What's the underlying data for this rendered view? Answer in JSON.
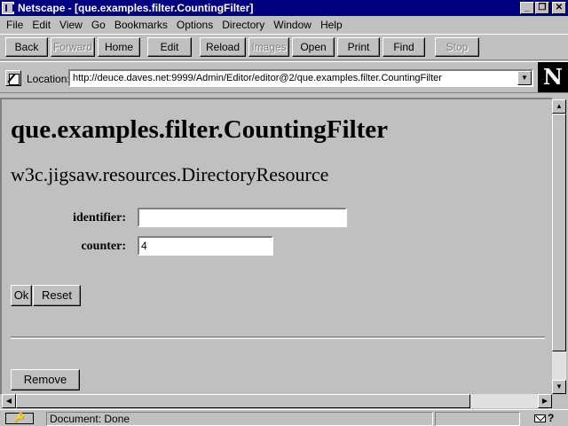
{
  "window": {
    "title": "Netscape - [que.examples.filter.CountingFilter]",
    "minimize_glyph": "_",
    "restore_glyph": "❐",
    "close_glyph": "✕"
  },
  "menu": [
    "File",
    "Edit",
    "View",
    "Go",
    "Bookmarks",
    "Options",
    "Directory",
    "Window",
    "Help"
  ],
  "toolbar": {
    "back": "Back",
    "forward": "Forward",
    "home": "Home",
    "edit": "Edit",
    "reload": "Reload",
    "images": "Images",
    "open": "Open",
    "print": "Print",
    "find": "Find",
    "stop": "Stop"
  },
  "location": {
    "label": "Location:",
    "url": "http://deuce.daves.net:9999/Admin/Editor/editor@2/que.examples.filter.CountingFilter",
    "dropdown_glyph": "▼"
  },
  "logo": {
    "letter": "N"
  },
  "page": {
    "heading": "que.examples.filter.CountingFilter",
    "subheading": "w3c.jigsaw.resources.DirectoryResource",
    "form": {
      "identifier_label": "identifier:",
      "identifier_value": "",
      "counter_label": "counter:",
      "counter_value": "4",
      "ok_label": "Ok",
      "reset_label": "Reset",
      "remove_label": "Remove"
    }
  },
  "scrollbar": {
    "up": "▲",
    "down": "▼",
    "left": "◀",
    "right": "▶"
  },
  "status": {
    "security_icon": "key-icon",
    "text": "Document: Done",
    "help": "?"
  }
}
